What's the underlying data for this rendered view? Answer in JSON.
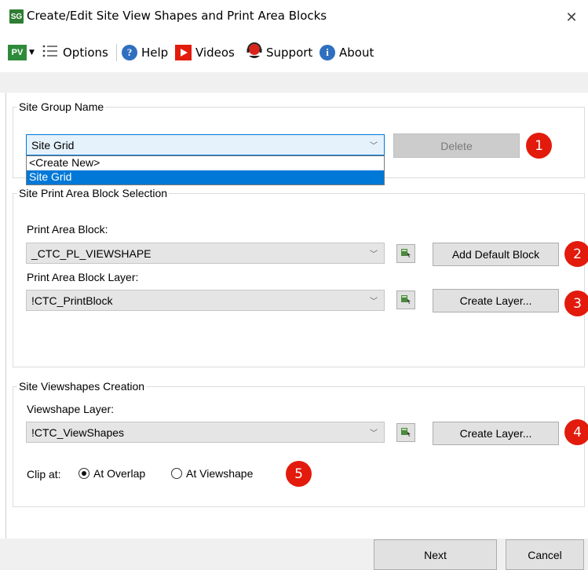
{
  "window": {
    "app_icon_text": "SG",
    "title": "Create/Edit Site View Shapes and Print Area Blocks",
    "close_glyph": "✕"
  },
  "toolbar": {
    "pv_logo_text": "PV",
    "options_label": "Options",
    "help_label": "Help",
    "videos_label": "Videos",
    "support_label": "Support",
    "about_label": "About"
  },
  "site_group": {
    "title": "Site Group Name",
    "selected_value": "Site Grid",
    "options": [
      "<Create New>",
      "Site Grid"
    ],
    "delete_label": "Delete"
  },
  "print_block": {
    "title": "Site Print Area Block Selection",
    "block_label": "Print Area Block:",
    "block_value": "_CTC_PL_VIEWSHAPE",
    "add_default_label": "Add Default Block",
    "layer_label": "Print Area Block Layer:",
    "layer_value": "!CTC_PrintBlock",
    "create_layer_label": "Create Layer..."
  },
  "viewshapes": {
    "title": "Site Viewshapes Creation",
    "layer_label": "Viewshape Layer:",
    "layer_value": "!CTC_ViewShapes",
    "create_layer_label": "Create Layer...",
    "clip_label": "Clip at:",
    "clip_options": [
      "At Overlap",
      "At Viewshape"
    ],
    "clip_selected": "At Overlap"
  },
  "badges": [
    "1",
    "2",
    "3",
    "4",
    "5"
  ],
  "footer": {
    "next_label": "Next",
    "cancel_label": "Cancel"
  },
  "colors": {
    "badge": "#e21b0c",
    "selection": "#0078d7",
    "pv_green": "#2e8b3a"
  }
}
